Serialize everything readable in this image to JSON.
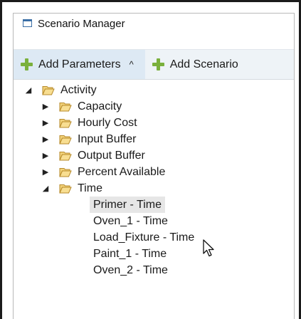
{
  "window": {
    "title": "Scenario Manager",
    "icon": "window-icon"
  },
  "toolbar": {
    "add_parameters_label": "Add Parameters",
    "add_parameters_caret": "^",
    "add_scenario_label": "Add Scenario",
    "accent_color": "#7ab03c"
  },
  "tree": {
    "root": {
      "label": "Activity",
      "expanded": true
    },
    "children": [
      {
        "label": "Capacity",
        "expanded": false
      },
      {
        "label": "Hourly Cost",
        "expanded": false
      },
      {
        "label": "Input Buffer",
        "expanded": false
      },
      {
        "label": "Output Buffer",
        "expanded": false
      },
      {
        "label": "Percent Available",
        "expanded": false
      },
      {
        "label": "Time",
        "expanded": true
      }
    ],
    "time_items": [
      {
        "label": "Primer - Time",
        "selected": true
      },
      {
        "label": "Oven_1 - Time",
        "selected": false
      },
      {
        "label": "Load_Fixture - Time",
        "selected": false
      },
      {
        "label": "Paint_1 - Time",
        "selected": false
      },
      {
        "label": "Oven_2 - Time",
        "selected": false
      }
    ],
    "expanded_glyph": "◢",
    "collapsed_glyph": "▶"
  }
}
